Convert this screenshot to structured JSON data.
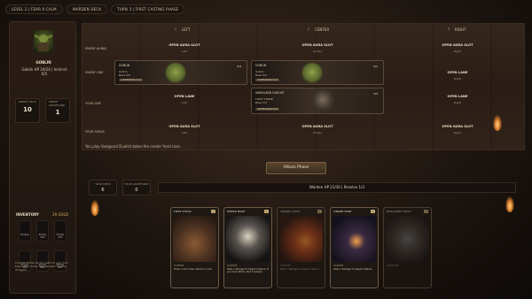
{
  "topbar": {
    "level": "LEVEL 2 | FEAR 0 CALM",
    "deck": "WARDEN DECK",
    "turn": "TURN 3 | FIRST CASTING PHASE"
  },
  "enemy": {
    "name": "GOBLIN",
    "stats": "Goblin HP 24/24 | Instinct 0/5",
    "deck_label": "ENEMY DECK",
    "deck_count": "10",
    "graveyard_label": "ENEMY GRAVEYARD",
    "graveyard_count": "1"
  },
  "inventory": {
    "title": "INVENTORY",
    "gold": "29 GOLD",
    "slots": [
      "Escape",
      "Empty Slot",
      "Empty Slot",
      "Empty Slot",
      "Empty Slot",
      "Empty Slot"
    ],
    "note": "Combat items can be used on your turn. Exploration tools stay packed until the dungeon."
  },
  "board": {
    "columns": [
      {
        "num": "1",
        "label": "LEFT"
      },
      {
        "num": "2",
        "label": "CENTER"
      },
      {
        "num": "3",
        "label": "RIGHT"
      }
    ],
    "rows": [
      "ENEMY AURAS",
      "ENEMY LINE",
      "YOUR LINE",
      "YOUR AURAS"
    ],
    "enemy_auras": [
      {
        "title": "OPEN AURA SLOT",
        "sub": "Left"
      },
      {
        "title": "OPEN AURA SLOT",
        "sub": "Center"
      },
      {
        "title": "OPEN AURA SLOT",
        "sub": "Right"
      }
    ],
    "enemy_line": {
      "left": {
        "name": "GOBLIN",
        "hp": "Goblin",
        "hp2": "Base 5/5",
        "tag": "SUMMONING SICK",
        "count": "4/4"
      },
      "center": {
        "name": "GOBLIN",
        "hp": "Goblin",
        "hp2": "Base 5/5",
        "tag": "SUMMONING SICK",
        "count": "4/4"
      },
      "right": {
        "title": "OPEN LANE",
        "sub": "Right"
      }
    },
    "your_line": {
      "left": {
        "title": "OPEN LANE",
        "sub": "Left"
      },
      "center": {
        "name": "VANGUARD DUELIST",
        "hp": "FIRST STRIKE",
        "hp2": "Base 3/3",
        "tag": "SUMMONING SICK",
        "count": "3/3"
      },
      "right": {
        "title": "OPEN LANE",
        "sub": "Right"
      }
    },
    "your_auras": [
      {
        "title": "OPEN AURA SLOT",
        "sub": "Left"
      },
      {
        "title": "OPEN AURA SLOT",
        "sub": "Center"
      },
      {
        "title": "OPEN AURA SLOT",
        "sub": "Right"
      }
    ],
    "message": "You play Vanguard Duelist takes the center front lane."
  },
  "player": {
    "attack_button": "Attack Phase",
    "deck_label": "YOUR DECK",
    "deck_count": "6",
    "graveyard_label": "YOUR GRAVEYARD",
    "graveyard_count": "0",
    "status": "Warden HP 21/30 | Resolve 1/3"
  },
  "hand": [
    {
      "title": "FIRST STOCK",
      "cost": "1",
      "type": "CANTRIP",
      "text": "Draw 1 card, then discard 1 card.",
      "art": "feast",
      "dim": false
    },
    {
      "title": "SHIELD BASH",
      "cost": "1",
      "type": "CANTRIP",
      "text": "Deal 1 damage to target creature. If you have Ward, deal 2 instead.",
      "art": "shield",
      "dim": false
    },
    {
      "title": "CINDER LANCE",
      "cost": "2",
      "type": "SORCERY",
      "text": "Deal 3 damage to target creature.",
      "art": "fire",
      "dim": true
    },
    {
      "title": "CINDER DART",
      "cost": "1",
      "type": "CANTRIP",
      "text": "Deal 1 damage to target creature.",
      "art": "ember",
      "dim": false
    },
    {
      "title": "BARGAINER SPIRIT",
      "cost": "3",
      "type": "CREATURE",
      "text": "",
      "art": "rest",
      "dim": true
    }
  ]
}
